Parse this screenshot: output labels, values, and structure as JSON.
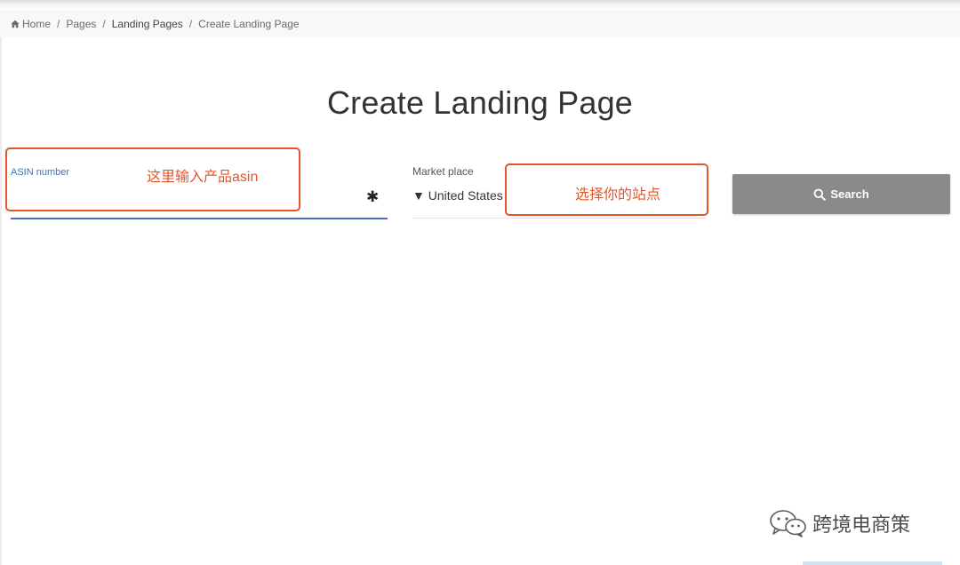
{
  "breadcrumb": {
    "items": [
      {
        "label": "Home",
        "icon": "home-icon"
      },
      {
        "label": "Pages"
      },
      {
        "label": "Landing Pages"
      },
      {
        "label": "Create Landing Page"
      }
    ],
    "separator": "/"
  },
  "page": {
    "title": "Create Landing Page"
  },
  "form": {
    "asin": {
      "label": "ASIN number",
      "value": "",
      "required_mark": "✱"
    },
    "marketplace": {
      "label": "Market place",
      "selected": "▼ United States"
    },
    "search_button": {
      "label": "Search",
      "icon": "search-icon"
    }
  },
  "annotations": {
    "asin_note": "这里输入产品asin",
    "market_note": "选择你的站点",
    "color": "#e2552b"
  },
  "watermark": {
    "text": "跨境电商策",
    "icon": "wechat-icon"
  },
  "colors": {
    "accent_blue": "#3f74b8",
    "button_gray": "#8a8a8a"
  }
}
